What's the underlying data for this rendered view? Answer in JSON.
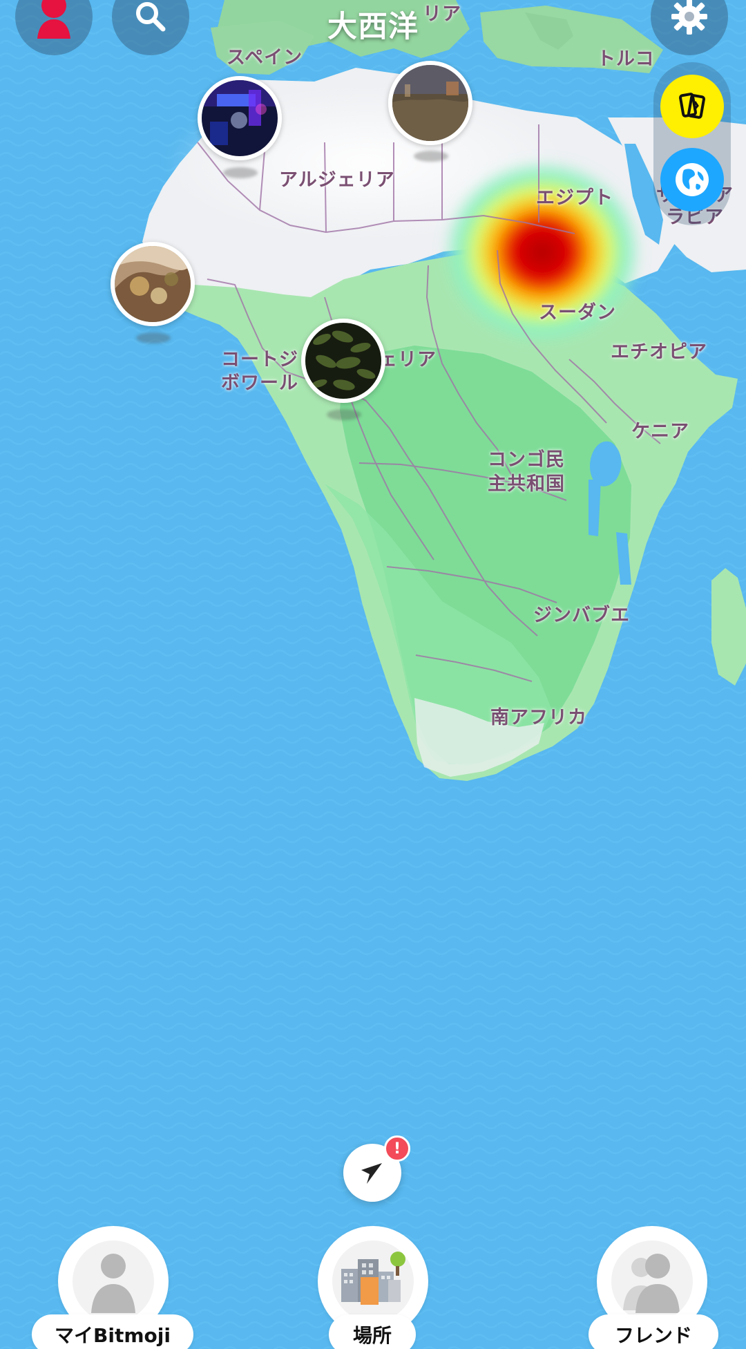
{
  "header": {
    "title": "大西洋"
  },
  "map_labels": {
    "spain": "スペイン",
    "italy_partial": "リア",
    "turkey": "トルコ",
    "algeria": "アルジェリア",
    "egypt": "エジプト",
    "saudi_line1": "サウジア",
    "saudi_line2": "ラビア",
    "sudan": "スーダン",
    "nigeria_partial": "ェリア",
    "ivory_coast_line1": "コートジ",
    "ivory_coast_line2": "ボワール",
    "ethiopia": "エチオピア",
    "kenya": "ケニア",
    "drc_line1": "コンゴ民",
    "drc_line2": "主共和国",
    "zimbabwe": "ジンバブエ",
    "south_africa": "南アフリカ"
  },
  "top_controls": [
    {
      "name": "profile-avatar",
      "icon": "person-icon"
    },
    {
      "name": "search-button",
      "icon": "search-icon"
    },
    {
      "name": "settings-button",
      "icon": "gear-icon"
    }
  ],
  "side_actions": [
    {
      "name": "explore-button",
      "icon": "cards-icon",
      "color": "#ffef00"
    },
    {
      "name": "globe-button",
      "icon": "globe-icon",
      "color": "#1ea7ff"
    }
  ],
  "stories": [
    {
      "name": "spain-story",
      "theme": "night-club"
    },
    {
      "name": "north-story",
      "theme": "dusk-field"
    },
    {
      "name": "west-story",
      "theme": "food-closeup"
    },
    {
      "name": "nigeria-story",
      "theme": "dark-foliage"
    }
  ],
  "locate": {
    "badge": "!"
  },
  "bottom_nav": {
    "my_bitmoji": "マイBitmoji",
    "places": "場所",
    "friends": "フレンド"
  },
  "colors": {
    "ocean": "#58b8ef",
    "land_north": "#eef0f3",
    "land_green": "#a8e6b0",
    "land_greener": "#7edc97",
    "border": "#a073a6",
    "heat": "#e00000",
    "badge": "#f34b59"
  }
}
